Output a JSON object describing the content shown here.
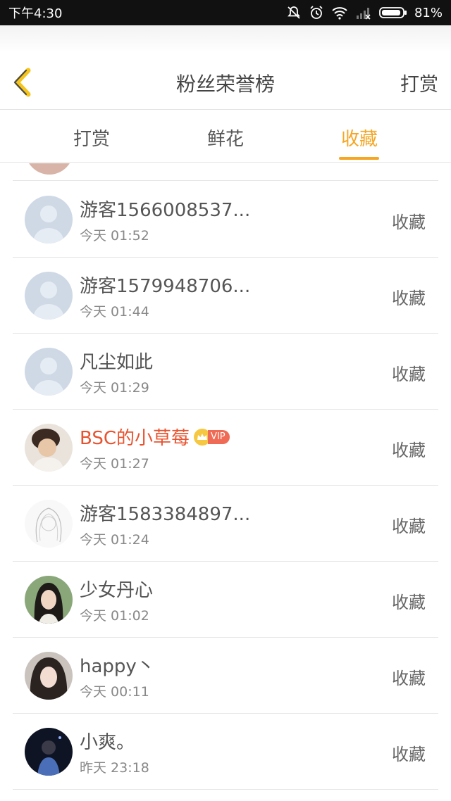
{
  "status": {
    "time": "下午4:30",
    "battery": "81%"
  },
  "nav": {
    "title": "粉丝荣誉榜",
    "right_action": "打赏"
  },
  "tabs": [
    {
      "label": "打赏",
      "active": false
    },
    {
      "label": "鲜花",
      "active": false
    },
    {
      "label": "收藏",
      "active": true
    }
  ],
  "colors": {
    "accent": "#f5a623",
    "vip_name": "#e8532f"
  },
  "rows": [
    {
      "name": "游客1566008537...",
      "time": "今天 01:52",
      "action": "收藏",
      "avatar": "default-avatar",
      "vip": false
    },
    {
      "name": "游客1579948706...",
      "time": "今天 01:44",
      "action": "收藏",
      "avatar": "default-avatar",
      "vip": false
    },
    {
      "name": "凡尘如此",
      "time": "今天 01:29",
      "action": "收藏",
      "avatar": "default-avatar",
      "vip": false
    },
    {
      "name": "BSC的小草莓",
      "time": "今天 01:27",
      "action": "收藏",
      "avatar": "photo-avatar",
      "vip": true,
      "vip_label": "VIP"
    },
    {
      "name": "游客1583384897...",
      "time": "今天 01:24",
      "action": "收藏",
      "avatar": "sketch-avatar",
      "vip": false
    },
    {
      "name": "少女丹心",
      "time": "今天 01:02",
      "action": "收藏",
      "avatar": "photo-avatar",
      "vip": false
    },
    {
      "name": "happy丶",
      "time": "今天 00:11",
      "action": "收藏",
      "avatar": "photo-avatar",
      "vip": false
    },
    {
      "name": "小爽。",
      "time": "昨天 23:18",
      "action": "收藏",
      "avatar": "photo-avatar",
      "vip": false
    }
  ]
}
